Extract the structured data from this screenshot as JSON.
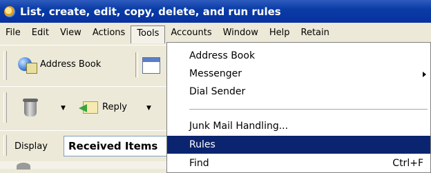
{
  "window": {
    "title": "List, create, edit, copy, delete, and run rules"
  },
  "menubar": {
    "items": [
      {
        "label": "File"
      },
      {
        "label": "Edit"
      },
      {
        "label": "View"
      },
      {
        "label": "Actions"
      },
      {
        "label": "Tools"
      },
      {
        "label": "Accounts"
      },
      {
        "label": "Window"
      },
      {
        "label": "Help"
      },
      {
        "label": "Retain"
      }
    ],
    "open_menu": "Tools"
  },
  "toolbar": {
    "address_book_label": "Address Book",
    "reply_label": "Reply",
    "display_label": "Display",
    "display_value": "Received Items"
  },
  "tools_menu": {
    "items": [
      {
        "label": "Address Book"
      },
      {
        "label": "Messenger",
        "submenu": true
      },
      {
        "label": "Dial Sender"
      },
      {
        "separator": true
      },
      {
        "label": "Junk Mail Handling..."
      },
      {
        "label": "Rules",
        "highlighted": true
      },
      {
        "label": "Find",
        "shortcut": "Ctrl+F"
      }
    ]
  },
  "colors": {
    "titlebar": "#0a3ca6",
    "menu_highlight": "#0b2470",
    "chrome": "#ece9d8"
  }
}
